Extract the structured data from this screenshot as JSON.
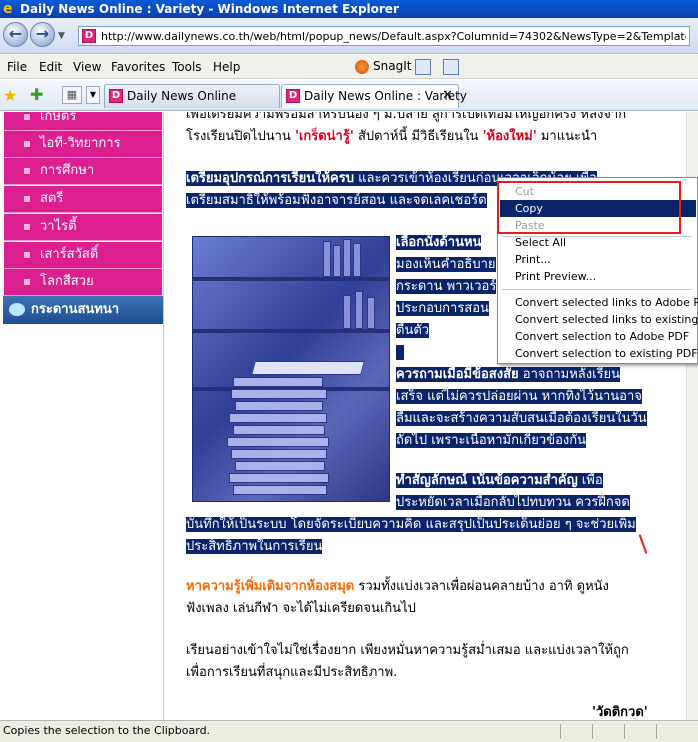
{
  "window": {
    "title": "Daily News Online : Variety - Windows Internet Explorer"
  },
  "address_bar": {
    "url": "http://www.dailynews.co.th/web/html/popup_news/Default.aspx?Columnid=74302&NewsType=2&Template=1"
  },
  "menu": [
    "File",
    "Edit",
    "View",
    "Favorites",
    "Tools",
    "Help"
  ],
  "toolbar": {
    "snagit_label": "SnagIt"
  },
  "tabs": [
    {
      "label": "Daily News Online"
    },
    {
      "label": "Daily News Online : Variety",
      "close": "✕"
    }
  ],
  "sidebar": {
    "items": [
      "เกษตร",
      "ไอที-วิทยาการ",
      "การศึกษา",
      "สตรี",
      "วาไรตี้",
      "เสาร์สวัสดิ์",
      "โลกสีสวย"
    ],
    "board": "กระดานสนทนา"
  },
  "article": {
    "intro_1a": "เพื่อเตรียมความพร้อมสำหรับน้อง ๆ ม.ปลาย สู่การเปิดเทอมใหญ่อีกครั้ง หลังจาก",
    "intro_2a": "โรงเรียนปิดไปนาน ",
    "intro_2b": "'เกร็ดน่ารู้'",
    "intro_2c": " สัปดาห์นี้ มีวิธีเรียนใน ",
    "intro_2d": "'ห้องใหม่'",
    "intro_2e": " มาแนะนำ",
    "p1_1a": "เตรียมอุปกรณ์การเรียนให้ครบ",
    "p1_1b": " และควรเข้าห้องเรียนก่อนเวลาเล็กน้อย เพื่อ",
    "p1_2": "เตรียมสมาธิให้พร้อมฟังอาจารย์สอน และจดเลคเชอร์ต",
    "p2_1": "เลือกนั่งด้านหน",
    "p2_2": "มองเห็นคำอธิบาย",
    "p2_3": "กระดาน พาวเวอร์",
    "p2_4": "ประกอบการสอน",
    "p2_5": "ตื่นตัว",
    "p3_1a": "ควรถามเมื่อมีข้อสงสัย",
    "p3_1b": " อาจถามหลังเรียน",
    "p3_2": "เสร็จ แต่ไม่ควรปล่อยผ่าน หากทิ้งไว้นานอาจ",
    "p3_3": "ลืมและจะสร้างความสับสนเมื่อต้องเรียนในวัน",
    "p3_4": "ถัดไป เพราะเนื้อหามักเกี่ยวข้องกัน",
    "p4_1a": "ทำสัญลักษณ์ เน้นข้อความสำคัญ",
    "p4_1b": " เพื่อ",
    "p4_2": "ประหยัดเวลาเมื่อกลับไปทบทวน ควรฝึกจด",
    "p4_3": "บันทึกให้เป็นระบบ โดยจัดระเบียบความคิด และสรุปเป็นประเด็นย่อย ๆ จะช่วยเพิ่ม",
    "p4_4": "ประสิทธิภาพในการเรียน",
    "p5_1a": "หาความรู้เพิ่มเติมจากห้องสมุด",
    "p5_1b": " รวมทั้งแบ่งเวลาเพื่อผ่อนคลายบ้าง อาทิ ดูหนัง",
    "p5_2": "ฟังเพลง เล่นกีฬา จะได้ไม่เครียดจนเกินไป",
    "p6_1": "เรียนอย่างเข้าใจไม่ใช่เรื่องยาก เพียงหมั่นหาความรู้สม่ำเสมอ และแบ่งเวลาให้ถูก",
    "p6_2": "เพื่อการเรียนที่สนุกและมีประสิทธิภาพ.",
    "signature": "'วัดติกวด'"
  },
  "context_menu": {
    "items": [
      {
        "label": "Cut",
        "state": "disabled"
      },
      {
        "label": "Copy",
        "state": "active"
      },
      {
        "label": "Paste",
        "state": "disabled"
      },
      {
        "label": "Select All",
        "state": "normal"
      },
      {
        "label": "Print...",
        "state": "normal"
      },
      {
        "label": "Print Preview...",
        "state": "normal"
      },
      {
        "label": "Convert selected links to Adobe PDF",
        "state": "normal"
      },
      {
        "label": "Convert selected links to existing PDF",
        "state": "normal"
      },
      {
        "label": "Convert selection to Adobe PDF",
        "state": "normal"
      },
      {
        "label": "Convert selection to existing PDF",
        "state": "normal"
      }
    ]
  },
  "status_bar": {
    "text": "Copies the selection to the Clipboard."
  },
  "colors": {
    "sidebar_pink": "#dd1e8e",
    "selection": "#0a246a",
    "accent_orange": "#ff6a00",
    "accent_red": "#d8001a",
    "highlight_box": "#e51e1e"
  }
}
